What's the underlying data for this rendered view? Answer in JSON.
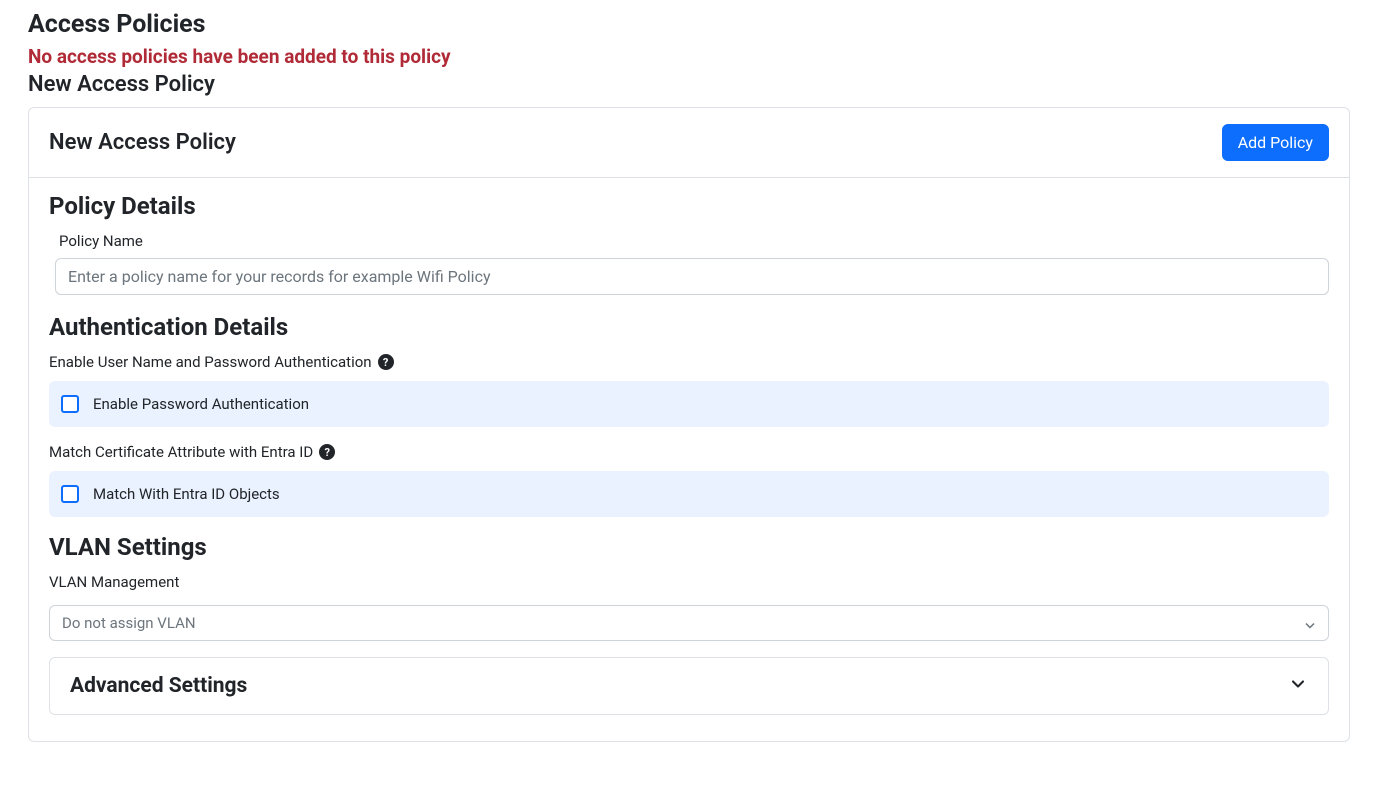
{
  "header": {
    "title": "Access Policies",
    "warning": "No access policies have been added to this policy",
    "subtitle": "New Access Policy"
  },
  "card": {
    "title": "New Access Policy",
    "add_button": "Add Policy"
  },
  "policyDetails": {
    "heading": "Policy Details",
    "name_label": "Policy Name",
    "name_placeholder": "Enter a policy name for your records for example Wifi Policy"
  },
  "authDetails": {
    "heading": "Authentication Details",
    "enablePasswordLabel": "Enable User Name and Password Authentication",
    "enablePasswordCheckbox": "Enable Password Authentication",
    "matchCertLabel": "Match Certificate Attribute with Entra ID",
    "matchCertCheckbox": "Match With Entra ID Objects"
  },
  "vlan": {
    "heading": "VLAN Settings",
    "management_label": "VLAN Management",
    "selected": "Do not assign VLAN"
  },
  "advanced": {
    "heading": "Advanced Settings"
  }
}
